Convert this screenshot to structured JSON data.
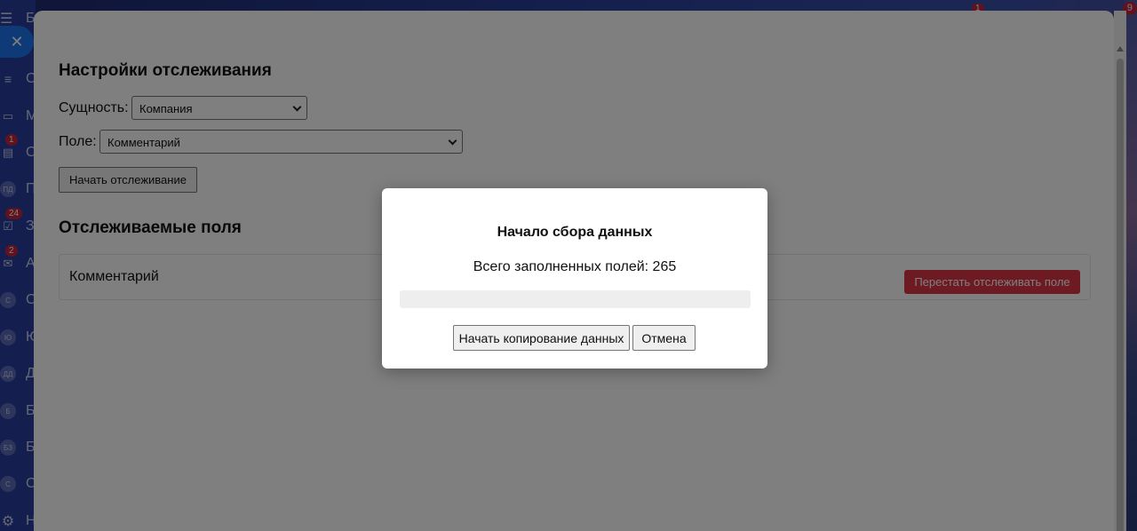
{
  "sidebar": {
    "items": [
      {
        "letter": "С",
        "icon": "filter-icon",
        "badge": ""
      },
      {
        "letter": "М",
        "icon": "chat-icon",
        "badge": ""
      },
      {
        "letter": "С",
        "icon": "inbox-icon",
        "badge": "1"
      },
      {
        "letter": "П",
        "icon": "ПД",
        "badge": ""
      },
      {
        "letter": "З",
        "icon": "tasks-icon",
        "badge": "24"
      },
      {
        "letter": "А",
        "icon": "mail-icon",
        "badge": "2"
      },
      {
        "letter": "С",
        "icon": "С",
        "badge": ""
      },
      {
        "letter": "Ю",
        "icon": "Ю",
        "badge": ""
      },
      {
        "letter": "Д",
        "icon": "ДД",
        "badge": ""
      },
      {
        "letter": "Б",
        "icon": "Б",
        "badge": ""
      },
      {
        "letter": "Б",
        "icon": "БЗ",
        "badge": ""
      },
      {
        "letter": "С",
        "icon": "С",
        "badge": ""
      },
      {
        "letter": "Н",
        "icon": "gear-icon",
        "badge": ""
      }
    ],
    "top_letter": "Б",
    "top_badge": "9",
    "top_badge2": "1"
  },
  "panel": {
    "settings_title": "Настройки отслеживания",
    "entity_label": "Сущность:",
    "entity_value": "Компания",
    "field_label": "Поле:",
    "field_value": "Комментарий",
    "start_tracking_button": "Начать отслеживание",
    "tracked_title": "Отслеживаемые поля",
    "tracked_fields": [
      {
        "name": "Комментарий",
        "stop_button": "Перестать отслеживать поле"
      }
    ]
  },
  "modal": {
    "title": "Начало сбора данных",
    "count_text": "Всего заполненных полей: 265",
    "progress": 0,
    "copy_button": "Начать копирование данных",
    "cancel_button": "Отмена"
  },
  "colors": {
    "accent_blue": "#1f74f0",
    "danger": "#dc3545",
    "badge": "#c0273d"
  }
}
